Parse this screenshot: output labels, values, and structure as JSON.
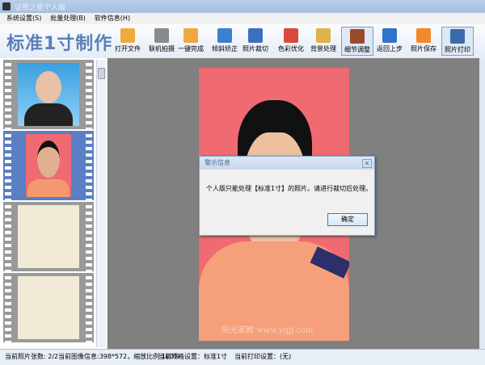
{
  "window": {
    "title": "证照之星个人版"
  },
  "menu": [
    "系统设置(S)",
    "批量处理(B)",
    "软件信息(H)"
  ],
  "toolbar": {
    "brand": "标准1寸制作",
    "buttons": [
      {
        "label": "打开文件",
        "icon": "folder-icon",
        "color": "#f2a93b"
      },
      {
        "label": "联机拍摄",
        "icon": "camera-icon",
        "color": "#8a8a8a"
      },
      {
        "label": "一键完成",
        "icon": "hand-pointer-icon",
        "color": "#f1a640"
      },
      {
        "label": "倾斜矫正",
        "icon": "rotate-icon",
        "color": "#3a7fd0"
      },
      {
        "label": "照片裁切",
        "icon": "crop-icon",
        "color": "#3c6fc2"
      },
      {
        "label": "色彩优化",
        "icon": "color-bars-icon",
        "color": "#d94a3a"
      },
      {
        "label": "背景处理",
        "icon": "brush-icon",
        "color": "#e1b24a"
      },
      {
        "label": "细节调整",
        "icon": "detail-chart-icon",
        "color": "#9a4a2a",
        "active": true
      },
      {
        "label": "返回上步",
        "icon": "undo-icon",
        "color": "#2f74c8"
      },
      {
        "label": "照片保存",
        "icon": "save-icon",
        "color": "#f08a2a"
      },
      {
        "label": "照片打印",
        "icon": "printer-icon",
        "color": "#3a6aa8",
        "active": true
      }
    ]
  },
  "dialog": {
    "title": "警示信息",
    "message": "个人版只能处理【标准1寸】的照片。请进行裁切后处理。",
    "ok": "确定"
  },
  "watermark": "阳光家教 www.ygjj.com",
  "status": {
    "count": "当前照片张数: 2/2",
    "image": "当前图像信息:398*572，缩放比例 100%",
    "spec": "当前规格设置：标准1寸",
    "print": "当前打印设置：(无)"
  }
}
